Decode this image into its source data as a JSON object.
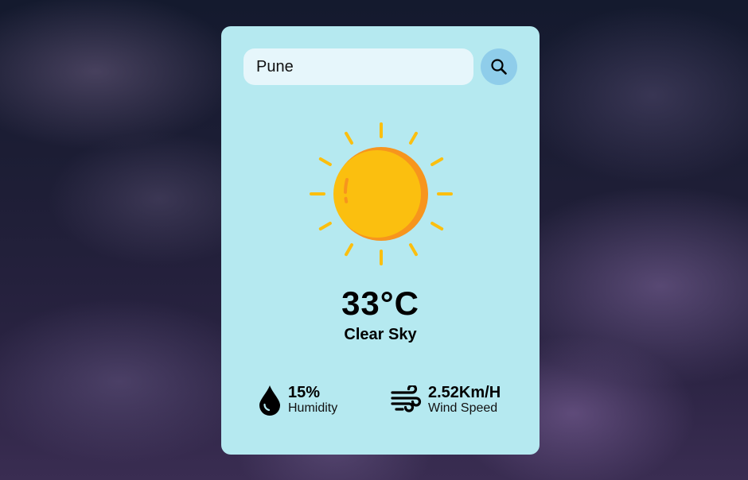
{
  "search": {
    "value": "Pune",
    "icon": "search-icon"
  },
  "weather": {
    "icon": "sun-icon",
    "temperature": "33°C",
    "condition": "Clear Sky"
  },
  "humidity": {
    "value": "15%",
    "label": "Humidity",
    "icon": "water-drop-icon"
  },
  "wind": {
    "value": "2.52Km/H",
    "label": "Wind Speed",
    "icon": "wind-icon"
  },
  "colors": {
    "card": "#b5e9f0",
    "input": "#e6f6fb",
    "search_button": "#8fcdea",
    "sun": "#fbbf0f",
    "sun_shade": "#f7951d"
  }
}
